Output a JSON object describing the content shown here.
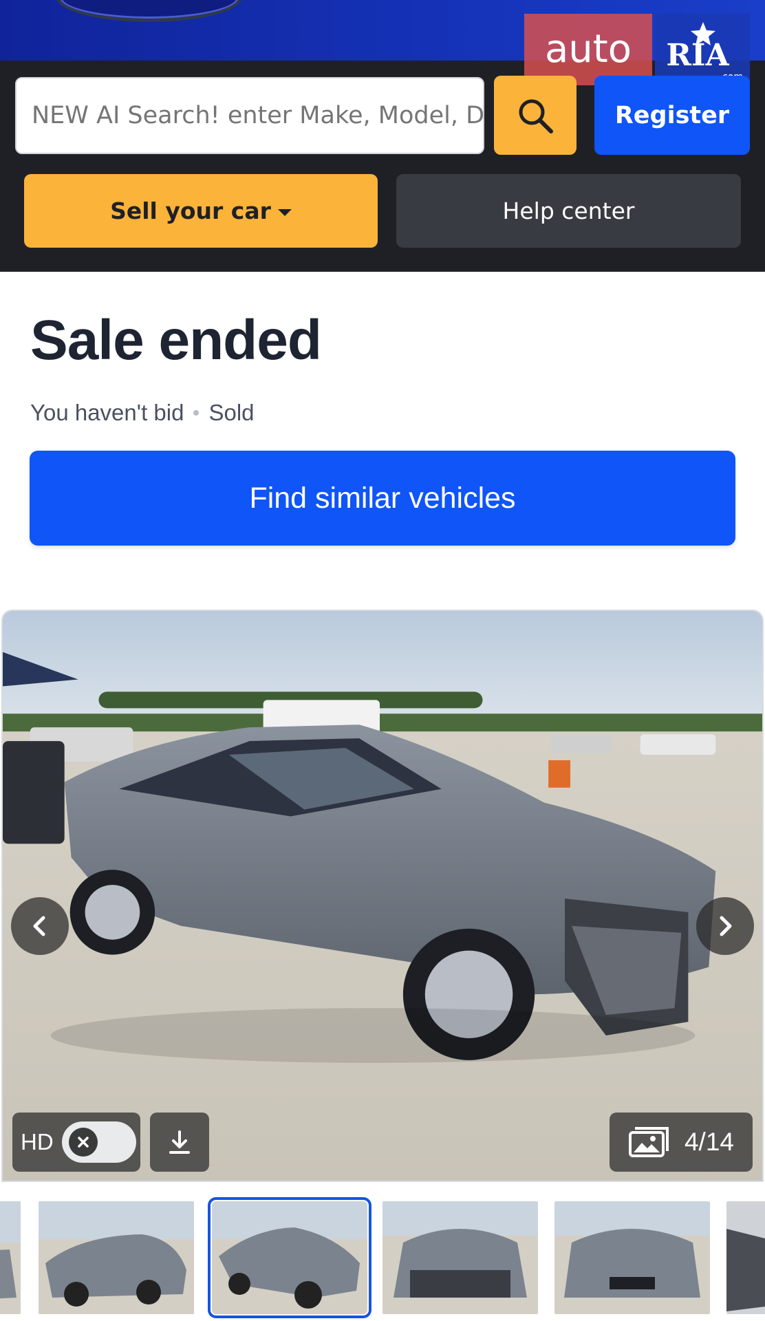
{
  "header": {
    "search": {
      "placeholder": "NEW AI Search! enter Make, Model, Damage",
      "value": ""
    },
    "register_label": "Register",
    "sell_label": "Sell your car",
    "help_label": "Help center",
    "watermark": {
      "auto": "auto",
      "ria": "RIA",
      "com": ".com"
    }
  },
  "status": {
    "title": "Sale ended",
    "bid_status": "You haven't bid",
    "sale_status": "Sold",
    "find_similar_label": "Find similar vehicles"
  },
  "gallery": {
    "hd_label": "HD",
    "hd_enabled": false,
    "counter": "4/14",
    "selected_index": 3,
    "thumbnail_count": 6
  },
  "colors": {
    "header_bg": "#1f2026",
    "brand_blue": "#0f55f7",
    "brand_yellow": "#fbb33a",
    "help_bg": "#393b42",
    "title_text": "#1f2433"
  },
  "icons": [
    "search-icon",
    "caret-down-icon",
    "chevron-left-icon",
    "chevron-right-icon",
    "close-icon",
    "download-icon",
    "gallery-icon"
  ]
}
